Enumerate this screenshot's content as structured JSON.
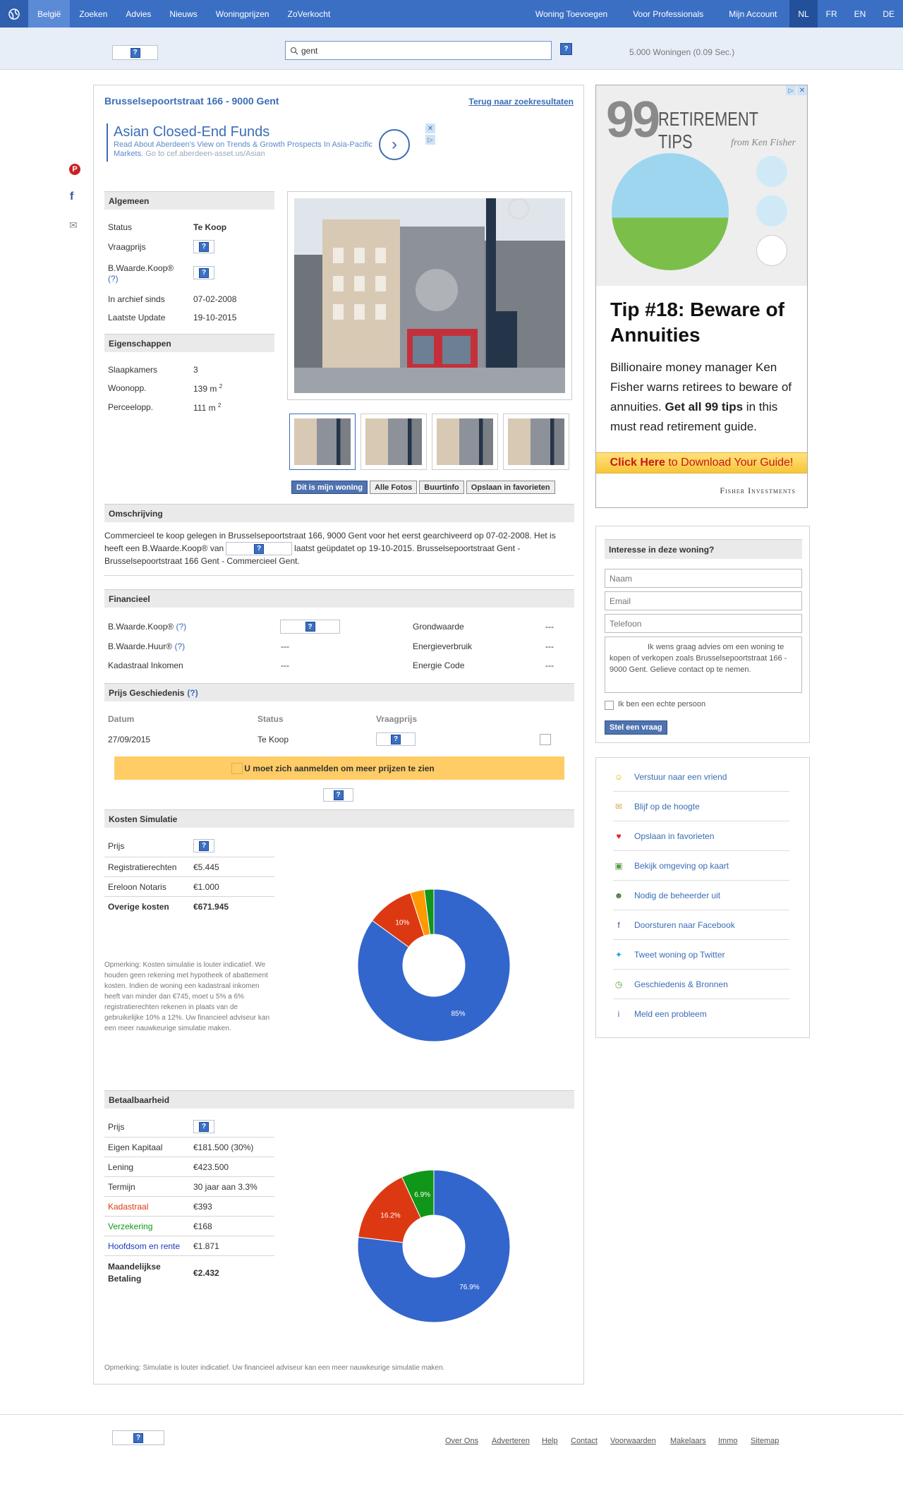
{
  "nav": {
    "left": [
      "België",
      "Zoeken",
      "Advies",
      "Nieuws",
      "Woningprijzen",
      "ZoVerkocht"
    ],
    "right": [
      "Woning Toevoegen",
      "Voor Professionals",
      "Mijn Account"
    ],
    "langs": [
      "NL",
      "FR",
      "EN",
      "DE"
    ]
  },
  "search": {
    "value": "gent",
    "result_count": "5.000 Woningen (0.09 Sec.)"
  },
  "listing": {
    "title": "Brusselsepoortstraat 166 - 9000 Gent",
    "back_link": "Terug naar zoekresultaten"
  },
  "ad_inline": {
    "title": "Asian Closed-End Funds",
    "text": "Read About Aberdeen's View on Trends & Growth Prospects In Asia-Pacific Markets.",
    "url": "Go to cef.aberdeen-asset.us/Asian"
  },
  "algemeen": {
    "heading": "Algemeen",
    "status_label": "Status",
    "status_value": "Te Koop",
    "vraagprijs_label": "Vraagprijs",
    "bwaarde_label": "B.Waarde.Koop®",
    "bwaarde_help": "(?)",
    "archief_label": "In archief sinds",
    "archief_value": "07-02-2008",
    "update_label": "Laatste Update",
    "update_value": "19-10-2015"
  },
  "eigenschappen": {
    "heading": "Eigenschappen",
    "slaap_label": "Slaapkamers",
    "slaap_value": "3",
    "woon_label": "Woonopp.",
    "woon_value": "139 m",
    "perceel_label": "Perceelopp.",
    "perceel_value": "111 m",
    "sup": "2"
  },
  "photo_buttons": [
    "Dit is mijn woning",
    "Alle Fotos",
    "Buurtinfo",
    "Opslaan in favorieten"
  ],
  "omschrijving": {
    "heading": "Omschrijving",
    "line1": "Commercieel te koop gelegen in Brusselsepoortstraat 166, 9000 Gent voor het eerst gearchiveerd op 07-02-2008. Het is",
    "line2a": "heeft een B.Waarde.Koop® van",
    "line2b": "laatst geüpdatet op 19-10-2015. Brusselsepoortstraat Gent -",
    "line3": "Brusselsepoortstraat 166 Gent - Commercieel Gent."
  },
  "financieel": {
    "heading": "Financieel",
    "bkoop": "B.Waarde.Koop®",
    "bhuur": "B.Waarde.Huur®",
    "help": "(?)",
    "kad": "Kadastraal Inkomen",
    "grond": "Grondwaarde",
    "energie": "Energieverbruik",
    "ecode": "Energie Code",
    "dash": "---"
  },
  "prijs_geschiedenis": {
    "heading": "Prijs Geschiedenis",
    "help": "(?)",
    "cols": [
      "Datum",
      "Status",
      "Vraagprijs"
    ],
    "row": {
      "date": "27/09/2015",
      "status": "Te Koop"
    },
    "login_banner": "U moet zich aanmelden om meer prijzen te zien"
  },
  "kosten": {
    "heading": "Kosten Simulatie",
    "rows": [
      {
        "label": "Prijs",
        "value": ""
      },
      {
        "label": "Registratierechten",
        "value": "€5.445"
      },
      {
        "label": "Ereloon Notaris",
        "value": "€1.000"
      },
      {
        "label": "Overige kosten",
        "value": "€671.945"
      }
    ],
    "note": "Opmerking: Kosten simulatie is louter indicatief. We houden geen rekening met hypotheek of abattement kosten. Indien de woning een kadastraal inkomen heeft van minder dan €745, moet u 5% a 6% registratierechten rekenen in plaats van de gebruikelijke 10% a 12%. Uw financieel adviseur kan een meer nauwkeurige simulatie maken."
  },
  "betaalbaarheid": {
    "heading": "Betaalbaarheid",
    "rows": [
      {
        "label": "Prijs",
        "value": ""
      },
      {
        "label": "Eigen Kapitaal",
        "value": "€181.500 (30%)"
      },
      {
        "label": "Lening",
        "value": "€423.500"
      },
      {
        "label": "Termijn",
        "value": "30 jaar aan 3.3%"
      },
      {
        "label": "Kadastraal",
        "value": "€393"
      },
      {
        "label": "Verzekering",
        "value": "€168"
      },
      {
        "label": "Hoofdsom en rente",
        "value": "€1.871"
      },
      {
        "label": "Maandelijkse Betaling",
        "value": "€2.432"
      }
    ],
    "note": "Opmerking: Simulatie is louter indicatief. Uw financieel adviseur kan een meer nauwkeurige simulatie maken."
  },
  "chart_data": [
    {
      "type": "pie",
      "donut": true,
      "values": [
        85,
        10,
        3,
        2
      ],
      "labels": [
        "85%",
        "10%",
        "",
        ""
      ],
      "colors": [
        "#3366cc",
        "#dc3912",
        "#ff9900",
        "#109618"
      ]
    },
    {
      "type": "pie",
      "donut": true,
      "values": [
        76.9,
        16.2,
        6.9
      ],
      "labels": [
        "76.9%",
        "16.2%",
        "6.9%"
      ],
      "colors": [
        "#3366cc",
        "#dc3912",
        "#109618"
      ]
    }
  ],
  "ad_side": {
    "number": "99",
    "headline": "RETIREMENT TIPS",
    "byline": "from Ken Fisher",
    "tip": "Tip #18: Beware of Annuities",
    "body_a": "Billionaire money manager Ken Fisher warns retirees to beware of annuities.",
    "body_b": "Get all 99 tips",
    "body_c": "in this must read retirement guide.",
    "cta_a": "Click Here",
    "cta_b": "to Download Your Guide!",
    "brand": "Fisher Investments"
  },
  "contact": {
    "heading": "Interesse in deze woning?",
    "name_ph": "Naam",
    "email_ph": "Email",
    "phone_ph": "Telefoon",
    "message": "Ik wens graag advies om een woning te kopen of verkopen zoals Brusselsepoortstraat 166 - 9000 Gent.  Gelieve contact op te nemen.",
    "human": "Ik ben een echte persoon",
    "submit": "Stel een vraag"
  },
  "side_links": [
    {
      "label": "Verstuur naar een vriend",
      "icon": "smiley-icon",
      "glyph": "☺",
      "color": "#e0b800"
    },
    {
      "label": "Blijf op de hoogte",
      "icon": "mail-icon",
      "glyph": "✉",
      "color": "#d9a441"
    },
    {
      "label": "Opslaan in favorieten",
      "icon": "heart-icon",
      "glyph": "♥",
      "color": "#d22"
    },
    {
      "label": "Bekijk omgeving op kaart",
      "icon": "map-icon",
      "glyph": "▣",
      "color": "#5a9a4a"
    },
    {
      "label": "Nodig de beheerder uit",
      "icon": "user-icon",
      "glyph": "☻",
      "color": "#4a7a3a"
    },
    {
      "label": "Doorsturen naar Facebook",
      "icon": "facebook-icon",
      "glyph": "f",
      "color": "#3b5998"
    },
    {
      "label": "Tweet woning op Twitter",
      "icon": "twitter-icon",
      "glyph": "✦",
      "color": "#1da1f2"
    },
    {
      "label": "Geschiedenis & Bronnen",
      "icon": "clock-icon",
      "glyph": "◷",
      "color": "#5a9a3a"
    },
    {
      "label": "Meld een probleem",
      "icon": "info-icon",
      "glyph": "i",
      "color": "#3b6fc4"
    }
  ],
  "footer_links": [
    "Over Ons",
    "Adverteren",
    "Help",
    "Contact",
    "Voorwaarden",
    "Makelaars",
    "Immo",
    "Sitemap"
  ]
}
